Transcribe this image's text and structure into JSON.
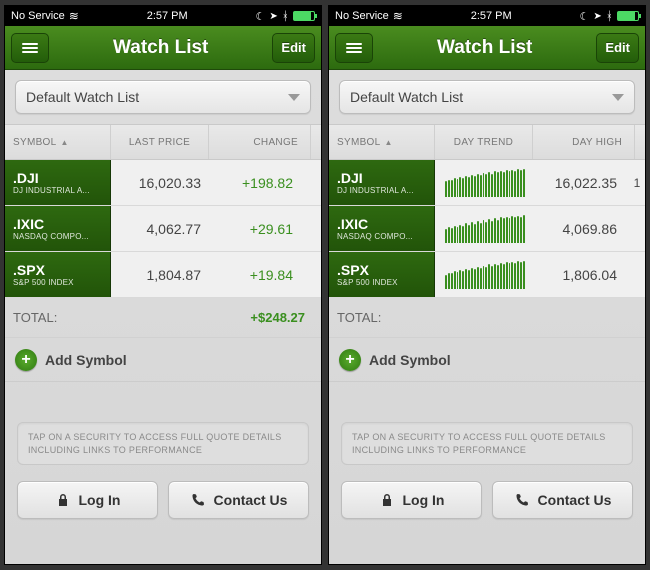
{
  "status": {
    "carrier": "No Service",
    "time": "2:57 PM"
  },
  "nav": {
    "title": "Watch List",
    "edit": "Edit"
  },
  "dropdown": {
    "selected": "Default Watch List"
  },
  "left": {
    "headers": {
      "c1": "SYMBOL",
      "c2": "LAST PRICE",
      "c3": "CHANGE"
    },
    "rows": [
      {
        "ticker": ".DJI",
        "name": "DJ INDUSTRIAL A...",
        "last": "16,020.33",
        "change": "+198.82"
      },
      {
        "ticker": ".IXIC",
        "name": "NASDAQ COMPO...",
        "last": "4,062.77",
        "change": "+29.61"
      },
      {
        "ticker": ".SPX",
        "name": "S&P 500 INDEX",
        "last": "1,804.87",
        "change": "+19.84"
      }
    ],
    "total_label": "TOTAL:",
    "total_value": "+$248.27"
  },
  "right": {
    "headers": {
      "c1": "SYMBOL",
      "c2": "DAY TREND",
      "c3": "DAY HIGH"
    },
    "rows": [
      {
        "ticker": ".DJI",
        "name": "DJ INDUSTRIAL A...",
        "high": "16,022.35",
        "peek": "1"
      },
      {
        "ticker": ".IXIC",
        "name": "NASDAQ COMPO...",
        "high": "4,069.86",
        "peek": ""
      },
      {
        "ticker": ".SPX",
        "name": "S&P 500 INDEX",
        "high": "1,806.04",
        "peek": ""
      }
    ],
    "total_label": "TOTAL:"
  },
  "add_symbol": "Add Symbol",
  "hint": "TAP ON A SECURITY TO ACCESS FULL QUOTE DETAILS INCLUDING LINKS TO PERFORMANCE",
  "bottom": {
    "login": "Log In",
    "contact": "Contact Us"
  }
}
